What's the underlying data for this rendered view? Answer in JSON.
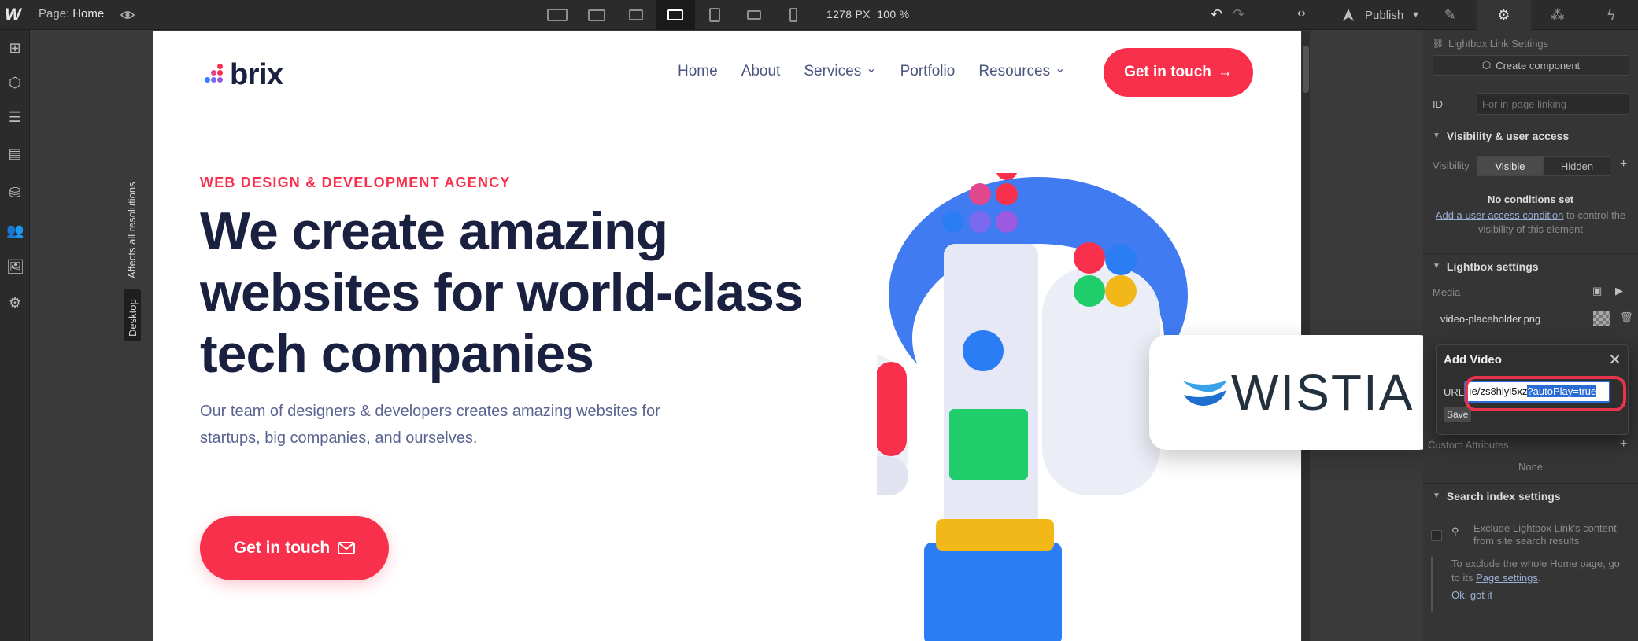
{
  "topbar": {
    "logo": "W",
    "page_label": "Page:",
    "page_name": "Home",
    "width_readout": "1278 PX",
    "zoom_readout": "100 %",
    "publish_label": "Publish",
    "device_icons": [
      "desktop-large-icon",
      "desktop-medium-icon",
      "desktop-small-icon",
      "desktop-base-icon",
      "tablet-icon",
      "mobile-landscape-icon",
      "mobile-portrait-icon"
    ],
    "active_device": "desktop-base-icon",
    "panel_tabs": [
      "style-brush-icon",
      "settings-gear-icon",
      "interactions-icon",
      "lightning-icon"
    ]
  },
  "left_toolbar": {
    "icons": [
      "add-panel-icon",
      "symbols-icon",
      "navigator-icon",
      "pages-icon",
      "cms-icon",
      "users-icon",
      "assets-icon",
      "settings-icon"
    ]
  },
  "canvas": {
    "breakpoint_tag": "Desktop",
    "breakpoint_note": "Affects all resolutions"
  },
  "site": {
    "brand_name": "brix",
    "nav": [
      {
        "label": "Home",
        "dropdown": false
      },
      {
        "label": "About",
        "dropdown": false
      },
      {
        "label": "Services",
        "dropdown": true
      },
      {
        "label": "Portfolio",
        "dropdown": false
      },
      {
        "label": "Resources",
        "dropdown": true
      }
    ],
    "cta_top": "Get in touch",
    "kicker": "WEB DESIGN & DEVELOPMENT AGENCY",
    "headline": "We create amazing websites for world-class tech companies",
    "subtext": "Our team of designers & developers creates amazing websites for startups, big companies, and ourselves.",
    "cta_bottom": "Get in touch",
    "accent_color": "#f9304c",
    "heading_color": "#1a2040"
  },
  "wistia_card": {
    "wordmark": "WISTIA"
  },
  "right_panel": {
    "component_header": "Lightbox Link Settings",
    "create_component": "Create component",
    "id_label": "ID",
    "id_placeholder": "For in-page linking",
    "visibility_section": "Visibility & user access",
    "visibility_label": "Visibility",
    "visibility_options": [
      "Visible",
      "Hidden"
    ],
    "no_conditions_title": "No conditions set",
    "no_conditions_link": "Add a user access condition",
    "no_conditions_text": "to control the visibility of this element",
    "lightbox_section": "Lightbox settings",
    "media_label": "Media",
    "media_file": "video-placeholder.png",
    "custom_attributes": "Custom Attributes",
    "custom_attributes_value": "None",
    "search_section": "Search index settings",
    "search_option": "Exclude Lightbox Link's content from site search results",
    "search_note_prefix": "To exclude the whole Home page, go to its",
    "search_note_link": "Page settings",
    "search_note_dismiss": "Ok, got it"
  },
  "add_video_modal": {
    "title": "Add Video",
    "url_label": "URL",
    "url_value_visible": "ıe/zs8hlyi5xz",
    "url_value_selected": "?autoPlay=true",
    "save_label": "Save"
  }
}
